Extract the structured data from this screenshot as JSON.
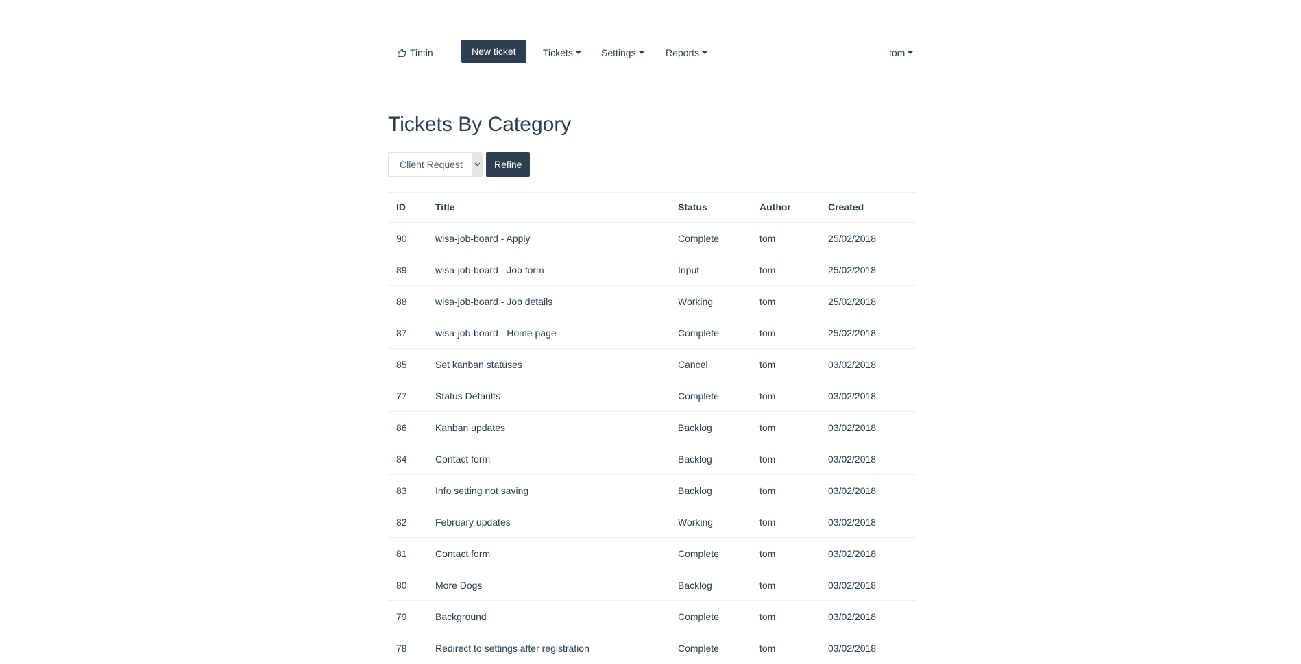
{
  "navbar": {
    "brand_label": "Tintin",
    "brand_icon": "thumbs-up-icon",
    "new_ticket_label": "New ticket",
    "menus": [
      {
        "label": "Tickets"
      },
      {
        "label": "Settings"
      },
      {
        "label": "Reports"
      }
    ],
    "user_label": "tom"
  },
  "page": {
    "title": "Tickets By Category"
  },
  "filter": {
    "selected_category": "Client Request",
    "refine_label": "Refine"
  },
  "table": {
    "headers": {
      "id": "ID",
      "title": "Title",
      "status": "Status",
      "author": "Author",
      "created": "Created"
    },
    "rows": [
      {
        "id": "90",
        "title": "wisa-job-board - Apply",
        "status": "Complete",
        "author": "tom",
        "created": "25/02/2018"
      },
      {
        "id": "89",
        "title": "wisa-job-board - Job form",
        "status": "Input",
        "author": "tom",
        "created": "25/02/2018"
      },
      {
        "id": "88",
        "title": "wisa-job-board - Job details",
        "status": "Working",
        "author": "tom",
        "created": "25/02/2018"
      },
      {
        "id": "87",
        "title": "wisa-job-board - Home page",
        "status": "Complete",
        "author": "tom",
        "created": "25/02/2018"
      },
      {
        "id": "85",
        "title": "Set kanban statuses",
        "status": "Cancel",
        "author": "tom",
        "created": "03/02/2018"
      },
      {
        "id": "77",
        "title": "Status Defaults",
        "status": "Complete",
        "author": "tom",
        "created": "03/02/2018"
      },
      {
        "id": "86",
        "title": "Kanban updates",
        "status": "Backlog",
        "author": "tom",
        "created": "03/02/2018"
      },
      {
        "id": "84",
        "title": "Contact form",
        "status": "Backlog",
        "author": "tom",
        "created": "03/02/2018"
      },
      {
        "id": "83",
        "title": "Info setting not saving",
        "status": "Backlog",
        "author": "tom",
        "created": "03/02/2018"
      },
      {
        "id": "82",
        "title": "February updates",
        "status": "Working",
        "author": "tom",
        "created": "03/02/2018"
      },
      {
        "id": "81",
        "title": "Contact form",
        "status": "Complete",
        "author": "tom",
        "created": "03/02/2018"
      },
      {
        "id": "80",
        "title": "More Dogs",
        "status": "Backlog",
        "author": "tom",
        "created": "03/02/2018"
      },
      {
        "id": "79",
        "title": "Background",
        "status": "Complete",
        "author": "tom",
        "created": "03/02/2018"
      },
      {
        "id": "78",
        "title": "Redirect to settings after registration",
        "status": "Complete",
        "author": "tom",
        "created": "03/02/2018"
      }
    ]
  }
}
